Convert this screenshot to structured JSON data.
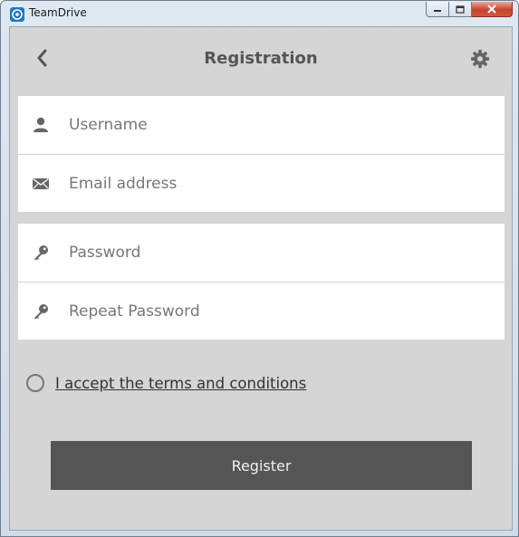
{
  "window": {
    "title": "TeamDrive",
    "icons": {
      "app": "teamdrive-logo-icon",
      "minimize": "minimize-icon",
      "maximize": "maximize-icon",
      "close": "close-icon"
    }
  },
  "header": {
    "title": "Registration",
    "back_icon": "chevron-left-icon",
    "settings_icon": "gear-icon"
  },
  "form": {
    "account_fields": [
      {
        "placeholder": "Username",
        "value": "",
        "icon": "user-icon"
      },
      {
        "placeholder": "Email address",
        "value": "",
        "icon": "envelope-icon"
      }
    ],
    "password_fields": [
      {
        "placeholder": "Password",
        "value": "",
        "icon": "key-icon"
      },
      {
        "placeholder": "Repeat Password",
        "value": "",
        "icon": "key-icon"
      }
    ],
    "terms_label": "I accept the terms and conditions",
    "terms_checked": false,
    "register_label": "Register"
  },
  "colors": {
    "background": "#d5d5d5",
    "button": "#555555",
    "title_text": "#555555",
    "icon": "#666666"
  }
}
